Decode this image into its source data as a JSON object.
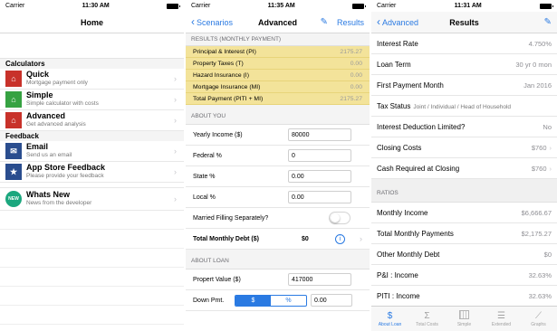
{
  "colors": {
    "accent": "#2a7ae2",
    "highlight": "#f3e39a"
  },
  "screen1": {
    "carrier": "Carrier",
    "time": "11:30 AM",
    "title": "Home",
    "calculators_header": "Calculators",
    "items": [
      {
        "main": "Quick",
        "sub": "Mortgage payment only",
        "icon": "house-icon"
      },
      {
        "main": "Simple",
        "sub": "Simple calculator with costs",
        "icon": "house-icon"
      },
      {
        "main": "Advanced",
        "sub": "Get advanced analysis",
        "icon": "house-icon"
      }
    ],
    "feedback_header": "Feedback",
    "feedback_items": [
      {
        "main": "Email",
        "sub": "Send us an email",
        "icon": "envelope-icon"
      },
      {
        "main": "App Store Feedback",
        "sub": "Please provide your feedback",
        "icon": "star-icon"
      }
    ],
    "whats_new": {
      "main": "Whats New",
      "sub": "News from the developer",
      "badge": "NEW"
    }
  },
  "screen2": {
    "carrier": "Carrier",
    "time": "11:35 AM",
    "back": "Scenarios",
    "title": "Advanced",
    "results": "Results",
    "results_header": "RESULTS (MONTHLY PAYMENT)",
    "results_rows": [
      {
        "label": "Principal & Interest (PI)",
        "value": "2175.27"
      },
      {
        "label": "Property Taxes (T)",
        "value": "0.00"
      },
      {
        "label": "Hazard Insurance (I)",
        "value": "0.00"
      },
      {
        "label": "Mortgage Insurance (MI)",
        "value": "0.00"
      },
      {
        "label": "Total Payment (PITI + MI)",
        "value": "2175.27"
      }
    ],
    "about_you_header": "ABOUT YOU",
    "yearly_income_label": "Yearly Income ($)",
    "yearly_income": "80000",
    "federal_label": "Federal %",
    "federal": "0",
    "state_label": "State %",
    "state": "0.00",
    "local_label": "Local %",
    "local": "0.00",
    "married_label": "Married Filling Separately?",
    "total_debt_label": "Total Monthly Debt ($)",
    "total_debt": "$0",
    "about_loan_header": "ABOUT LOAN",
    "property_value_label": "Propert Value ($)",
    "property_value": "417000",
    "down_pmt_label": "Down Pmt.",
    "seg_dollar": "$",
    "seg_percent": "%",
    "down_pmt": "0.00"
  },
  "screen3": {
    "carrier": "Carrier",
    "time": "11:31 AM",
    "back": "Advanced",
    "title": "Results",
    "rows": [
      {
        "label": "Interest Rate",
        "value": "4.750%"
      },
      {
        "label": "Loan Term",
        "value": "30 yr 0 mon"
      },
      {
        "label": "First Payment Month",
        "value": "Jan 2016"
      },
      {
        "label": "Tax Status",
        "note": "Joint / Individual / Head of Household",
        "value": ""
      },
      {
        "label": "Interest Deduction Limited?",
        "value": "No"
      },
      {
        "label": "Closing Costs",
        "value": "$760"
      },
      {
        "label": "Cash Required at Closing",
        "value": "$760"
      }
    ],
    "ratios_header": "RATIOS",
    "ratio_rows": [
      {
        "label": "Monthly Income",
        "value": "$6,666.67"
      },
      {
        "label": "Total Monthly Payments",
        "value": "$2,175.27"
      },
      {
        "label": "Other Monthly Debt",
        "value": "$0"
      },
      {
        "label": "P&I : Income",
        "value": "32.63%"
      },
      {
        "label": "PITI : Income",
        "value": "32.63%"
      }
    ],
    "tabs": [
      {
        "label": "About Loan",
        "icon": "dollar-icon"
      },
      {
        "label": "Total Costs",
        "icon": "sigma-icon"
      },
      {
        "label": "Simple",
        "icon": "grid-icon"
      },
      {
        "label": "Extended",
        "icon": "list-icon"
      },
      {
        "label": "Graphs",
        "icon": "chart-icon"
      }
    ]
  }
}
